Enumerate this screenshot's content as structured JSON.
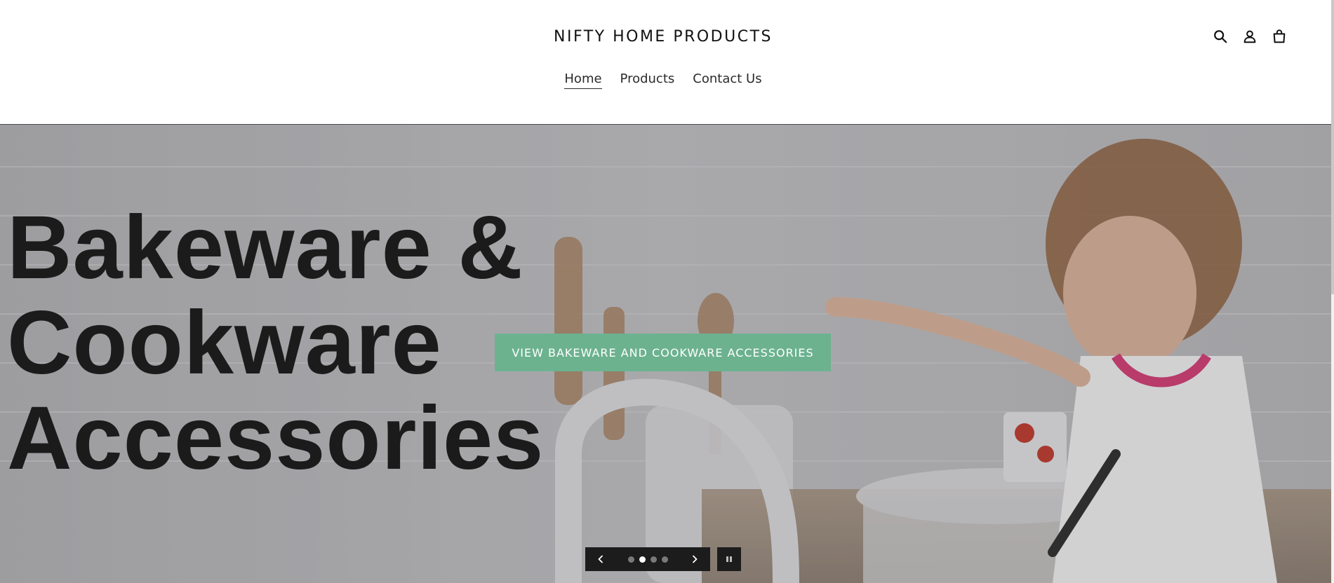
{
  "header": {
    "logo_text": "NIFTY HOME PRODUCTS",
    "nav": [
      {
        "label": "Home",
        "active": true
      },
      {
        "label": "Products",
        "active": false
      },
      {
        "label": "Contact Us",
        "active": false
      }
    ],
    "icons": [
      "search-icon",
      "account-icon",
      "cart-icon"
    ]
  },
  "hero": {
    "heading_lines": [
      "Bakeware &",
      "Cookware",
      "Accessories"
    ],
    "cta_label": "VIEW BAKEWARE AND COOKWARE ACCESSORIES",
    "cta_color": "#6cb28f",
    "slides_total": 4,
    "active_slide": 2,
    "controls": {
      "prev_icon": "chevron-left-icon",
      "next_icon": "chevron-right-icon",
      "pause_icon": "pause-icon"
    }
  }
}
